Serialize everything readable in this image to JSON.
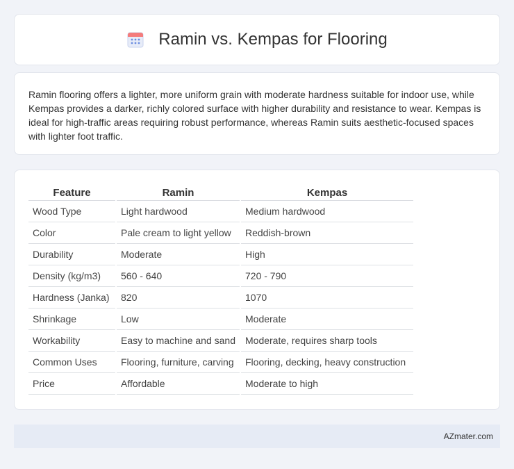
{
  "header": {
    "title": "Ramin vs. Kempas for Flooring",
    "icon": "calendar-icon",
    "icon_colors": {
      "top": "#f47c7c",
      "body": "#e7ecf8",
      "dots": "#6b8de0"
    }
  },
  "intro": {
    "text": "Ramin flooring offers a lighter, more uniform grain with moderate hardness suitable for indoor use, while Kempas provides a darker, richly colored surface with higher durability and resistance to wear. Kempas is ideal for high-traffic areas requiring robust performance, whereas Ramin suits aesthetic-focused spaces with lighter foot traffic."
  },
  "table": {
    "headers": [
      "Feature",
      "Ramin",
      "Kempas"
    ],
    "rows": [
      [
        "Wood Type",
        "Light hardwood",
        "Medium hardwood"
      ],
      [
        "Color",
        "Pale cream to light yellow",
        "Reddish-brown"
      ],
      [
        "Durability",
        "Moderate",
        "High"
      ],
      [
        "Density (kg/m3)",
        "560 - 640",
        "720 - 790"
      ],
      [
        "Hardness (Janka)",
        "820",
        "1070"
      ],
      [
        "Shrinkage",
        "Low",
        "Moderate"
      ],
      [
        "Workability",
        "Easy to machine and sand",
        "Moderate, requires sharp tools"
      ],
      [
        "Common Uses",
        "Flooring, furniture, carving",
        "Flooring, decking, heavy construction"
      ],
      [
        "Price",
        "Affordable",
        "Moderate to high"
      ]
    ]
  },
  "footer": {
    "text": "AZmater.com"
  }
}
